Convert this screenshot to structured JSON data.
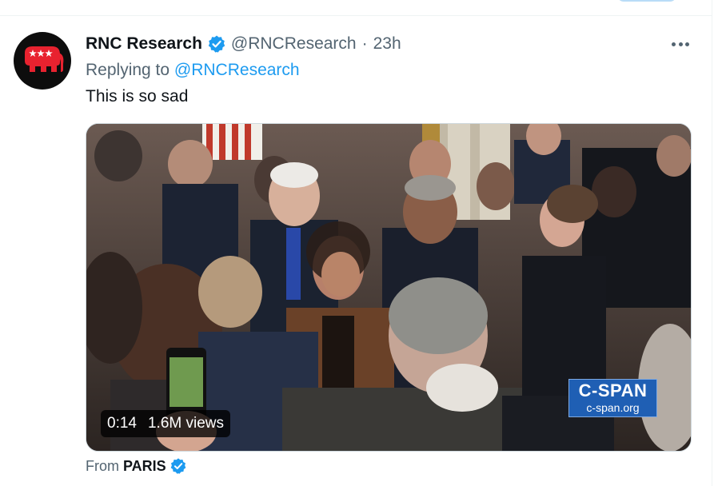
{
  "tweet": {
    "author": {
      "display_name": "RNC Research",
      "handle": "@RNCResearch",
      "verified": true
    },
    "separator": "·",
    "timestamp": "23h",
    "reply_prefix": "Replying to",
    "reply_to": "@RNCResearch",
    "text": "This is so sad",
    "media": {
      "type": "video",
      "duration": "0:14",
      "views": "1.6M views",
      "watermark": {
        "title": "C-SPAN",
        "url": "c-span.org"
      }
    },
    "source": {
      "prefix": "From",
      "name": "PARIS",
      "verified": true
    }
  },
  "colors": {
    "accent": "#1d9bf0",
    "text": "#0f1419",
    "muted": "#536471",
    "cspan_blue": "#1f5fb4",
    "logo_red": "#e8222f"
  },
  "icons": {
    "verified": "verified-badge-icon",
    "more": "more-options-icon",
    "avatar": "rnc-elephant-logo"
  }
}
